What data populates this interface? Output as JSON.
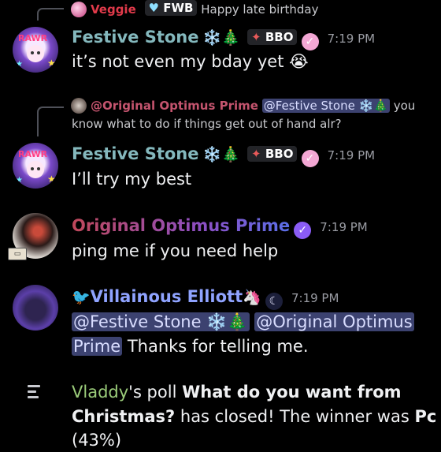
{
  "messages": [
    {
      "reply": {
        "author": "Veggie",
        "tag": "FWB",
        "text": "Happy late birthday"
      },
      "author": "Festive Stone",
      "author_emoji": "❄️🎄",
      "tag": "BBO",
      "time": "7:19 PM",
      "text": "it’s not even my bday yet",
      "text_emoji": "😭"
    },
    {
      "reply": {
        "author": "@Original Optimus Prime",
        "mention": "@Festive Stone ❄️🎄",
        "text_a": "you",
        "text_b": "know what to do if things get out of hand alr?"
      },
      "author": "Festive Stone",
      "author_emoji": "❄️🎄",
      "tag": "BBO",
      "time": "7:19 PM",
      "text": "I’ll try my best"
    },
    {
      "author": "Original Optimus Prime",
      "time": "7:19 PM",
      "text": "ping me if you need help"
    },
    {
      "author_prefix": "🐦",
      "author": "Villainous Elliott",
      "author_emoji": "🦄",
      "time": "7:19 PM",
      "mention_1": "@Festive Stone ❄️🎄",
      "mention_2a": "@Original Optimus",
      "mention_2b": "Prime",
      "text": "Thanks for telling me."
    }
  ],
  "poll": {
    "user": "Vladdy",
    "mid": "'s poll ",
    "question_a": "What do you want from",
    "question_b": "Christmas?",
    "closed": " has closed! The winner was ",
    "winner": "Pc",
    "percent": "(43%)"
  },
  "colors": {
    "festive_stone": "#84b8bd",
    "veggie": "#e03a4a",
    "elliott": "#8fa3ff",
    "poll_user": "#9bcc7a"
  }
}
